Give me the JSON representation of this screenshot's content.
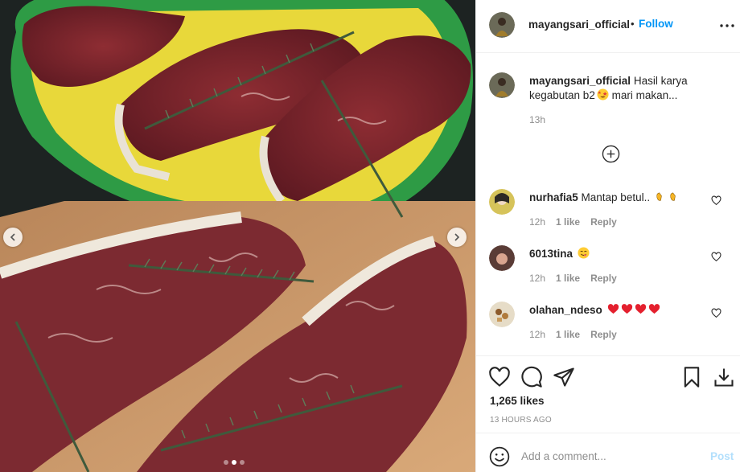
{
  "post": {
    "username": "mayangsari_official",
    "bullet": "•",
    "follow_label": "Follow",
    "more_icon": "more-horizontal-icon",
    "caption_text": "Hasil karya kegabutan b2",
    "caption_text_after": "mari makan...",
    "caption_time": "13h",
    "likes": "1,265 likes",
    "posted": "13 HOURS AGO",
    "media_dots": 3,
    "active_dot": 1
  },
  "comments": [
    {
      "username": "nurhafia5",
      "text": "Mantap betul..",
      "emoji": "clapping-hands",
      "time": "12h",
      "likes": "1 like",
      "reply": "Reply"
    },
    {
      "username": "6013tina",
      "text": "",
      "emoji": "yum-face",
      "time": "12h",
      "likes": "1 like",
      "reply": "Reply"
    },
    {
      "username": "olahan_ndeso",
      "text": "",
      "emoji": "four-red-hearts",
      "time": "12h",
      "likes": "1 like",
      "reply": "Reply"
    }
  ],
  "composer": {
    "placeholder": "Add a comment...",
    "post_label": "Post"
  },
  "colors": {
    "accent": "#0095f6",
    "post_disabled": "#b2dffc",
    "heart_red": "#ed4956"
  }
}
